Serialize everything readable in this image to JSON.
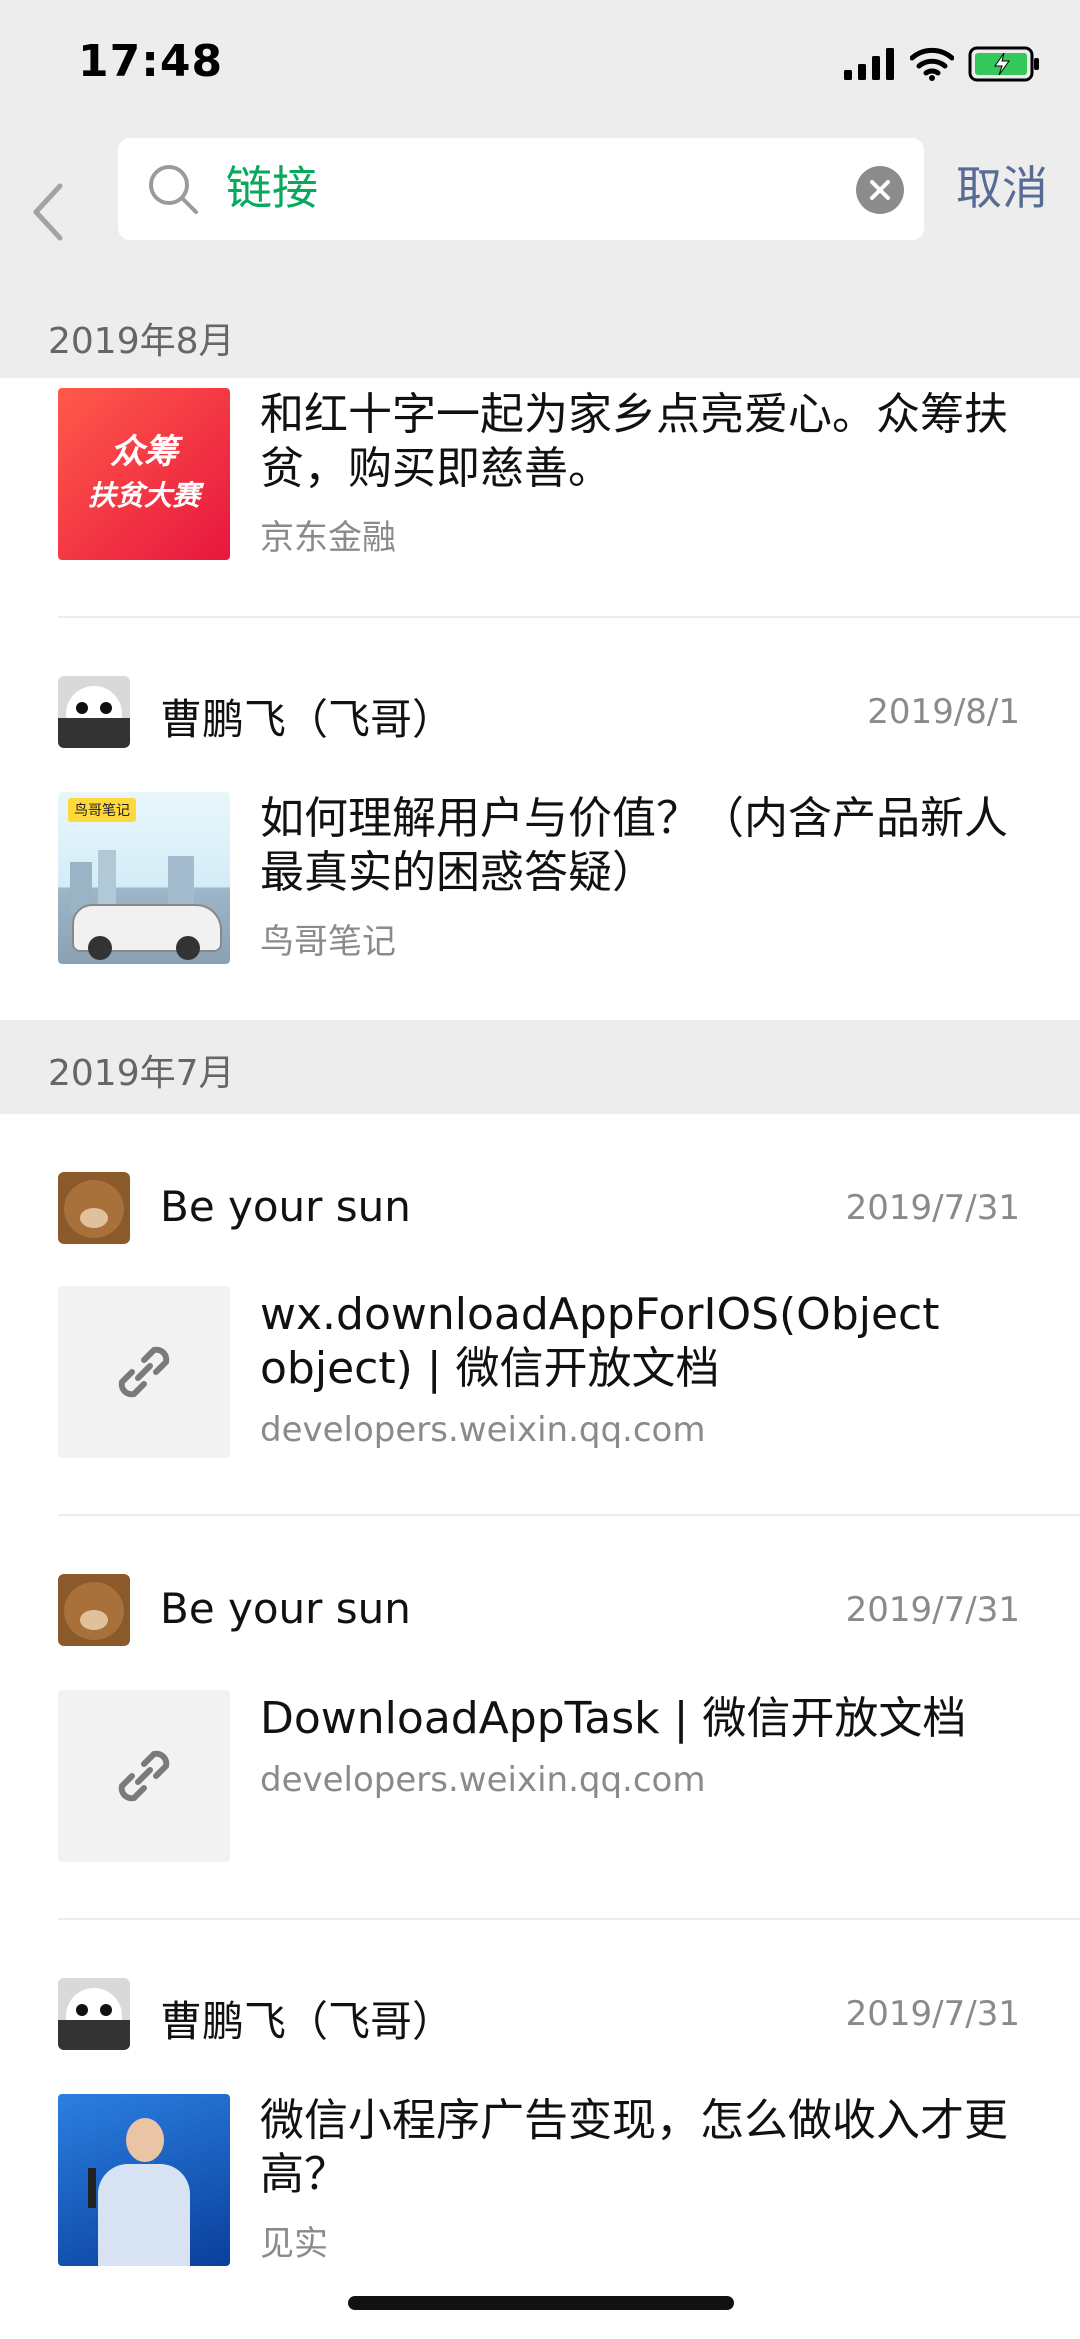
{
  "status_bar": {
    "time": "17:48"
  },
  "search": {
    "query": "链接",
    "cancel_label": "取消"
  },
  "sections": [
    {
      "label": "2019年8月",
      "items": [
        {
          "title": "和红十字一起为家乡点亮爱心。众筹扶贫，购买即慈善。",
          "source": "京东金融",
          "thumb_text": [
            "众筹",
            "扶贫大赛"
          ]
        },
        {
          "sender": "曹鹏飞（飞哥）",
          "date": "2019/8/1",
          "title": "如何理解用户与价值？（内含产品新人最真实的困惑答疑）",
          "source": "鸟哥笔记",
          "thumb_tag": "鸟哥笔记"
        }
      ]
    },
    {
      "label": "2019年7月",
      "items": [
        {
          "sender": "Be your sun",
          "date": "2019/7/31",
          "title": "wx.downloadAppForIOS(Object object) | 微信开放文档",
          "source": "developers.weixin.qq.com"
        },
        {
          "sender": "Be your sun",
          "date": "2019/7/31",
          "title": "DownloadAppTask | 微信开放文档",
          "source": "developers.weixin.qq.com"
        },
        {
          "sender": "曹鹏飞（飞哥）",
          "date": "2019/7/31",
          "title": "微信小程序广告变现，怎么做收入才更高？",
          "source": "见实"
        }
      ]
    }
  ],
  "icons": {
    "back": "chevron-left-icon",
    "search": "search-icon",
    "clear": "clear-icon",
    "link": "link-icon",
    "signal": "signal-icon",
    "wifi": "wifi-icon",
    "battery": "battery-charging-icon"
  },
  "colors": {
    "accent_green": "#07a95d",
    "link_blue": "#576b95",
    "battery_green": "#34c759"
  }
}
